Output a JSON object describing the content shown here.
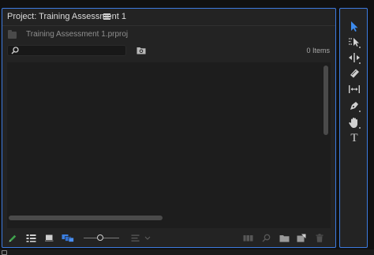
{
  "project_panel": {
    "title": "Project: Training Assessment 1",
    "project_file": "Training Assessment 1.prproj",
    "search": {
      "value": "",
      "placeholder": ""
    },
    "items_count": "0 Items"
  },
  "bottom_bar": {
    "icons": [
      "pencil-icon",
      "list-view-icon",
      "icon-view-icon",
      "freeform-view-icon",
      "zoom-slider",
      "sort-icon",
      "automate-to-sequence-icon",
      "find-icon",
      "new-bin-icon",
      "new-item-icon",
      "trash-icon"
    ]
  },
  "tools_panel": {
    "tools": [
      "selection-tool",
      "track-select-tool",
      "ripple-edit-tool",
      "razor-tool",
      "slip-tool",
      "pen-tool",
      "hand-tool",
      "type-tool"
    ],
    "active_tool": "selection-tool",
    "type_tool_glyph": "T"
  },
  "colors": {
    "accent": "#3d7be0",
    "panel_bg": "#232323",
    "pencil_green": "#3fa34d",
    "freeform_blue": "#3b7fe0"
  }
}
